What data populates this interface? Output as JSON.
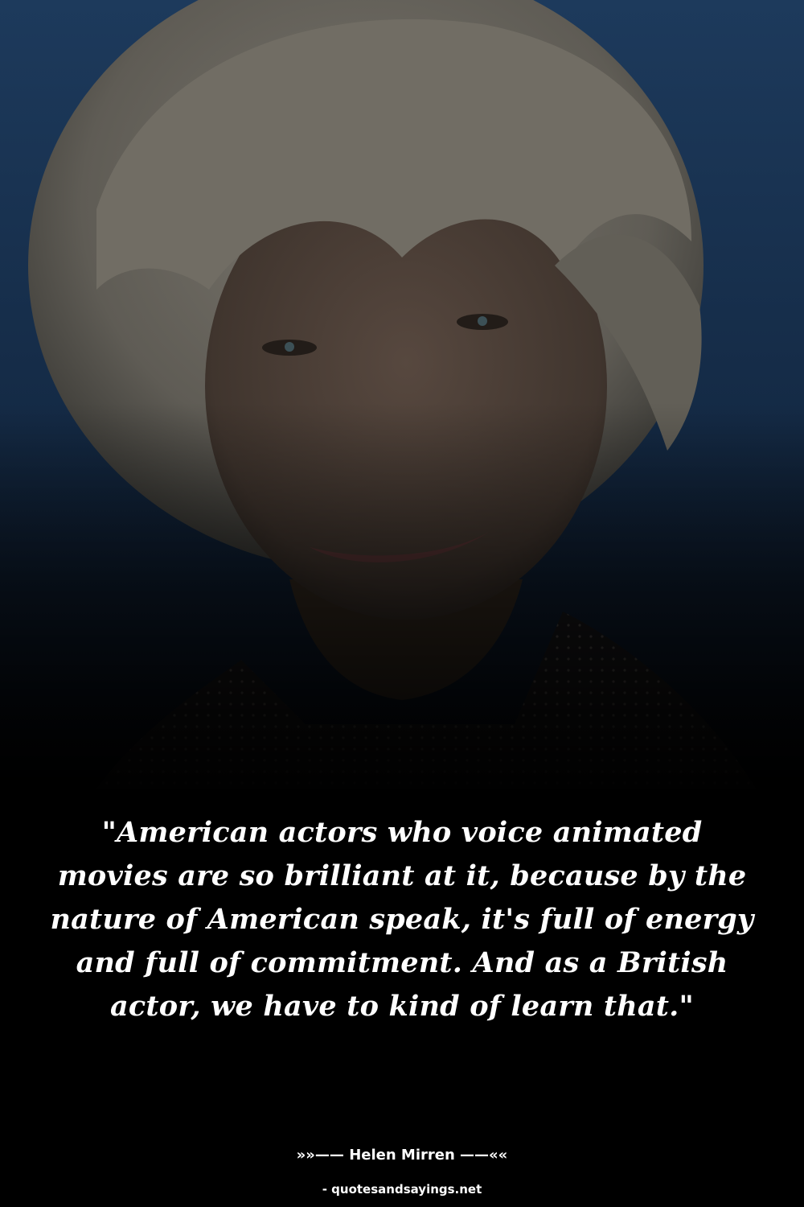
{
  "quote": {
    "text": "\"American actors who voice animated movies are so brilliant at it, because by the nature of American speak, it's full of energy and full of commitment. And as a British actor, we have to kind of learn that.\"",
    "author_line": "»»—— Helen Mirren ——««",
    "source": "- quotesandsayings.net"
  },
  "colors": {
    "background_top": "#1d3a5c",
    "background_bottom": "#000000",
    "hair": "#6e6a62",
    "text": "#ffffff"
  }
}
